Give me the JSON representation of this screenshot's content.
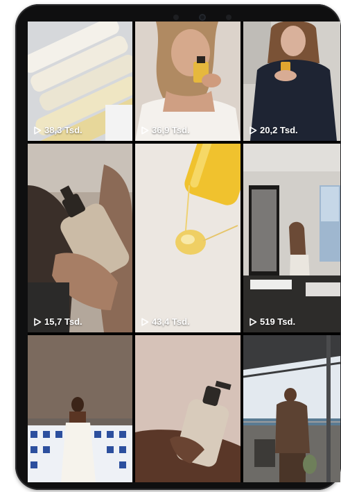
{
  "feed": {
    "tiles": [
      {
        "views": "38,3 Tsd.",
        "thumbnail": "serum-ampoules-on-stand"
      },
      {
        "views": "36,9 Tsd.",
        "thumbnail": "woman-holding-golden-serum-bottle"
      },
      {
        "views": "20,2 Tsd.",
        "thumbnail": "woman-in-navy-uniform-holding-product"
      },
      {
        "views": "15,7 Tsd.",
        "thumbnail": "hand-holding-babor-pump-bottle"
      },
      {
        "views": "43,4 Tsd.",
        "thumbnail": "golden-oil-pouring-from-bottle"
      },
      {
        "views": "519 Tsd.",
        "thumbnail": "woman-in-bathroom-by-window"
      },
      {
        "views": "",
        "thumbnail": "woman-in-white-dress-blue-tiles"
      },
      {
        "views": "",
        "thumbnail": "hand-holding-babor-pump-bottle-pink"
      },
      {
        "views": "",
        "thumbnail": "man-on-balcony-sea-view"
      }
    ]
  },
  "icons": {
    "play": "play-outline-icon"
  },
  "colors": {
    "device_frame": "#0f0f10",
    "overlay_text": "#ffffff"
  }
}
